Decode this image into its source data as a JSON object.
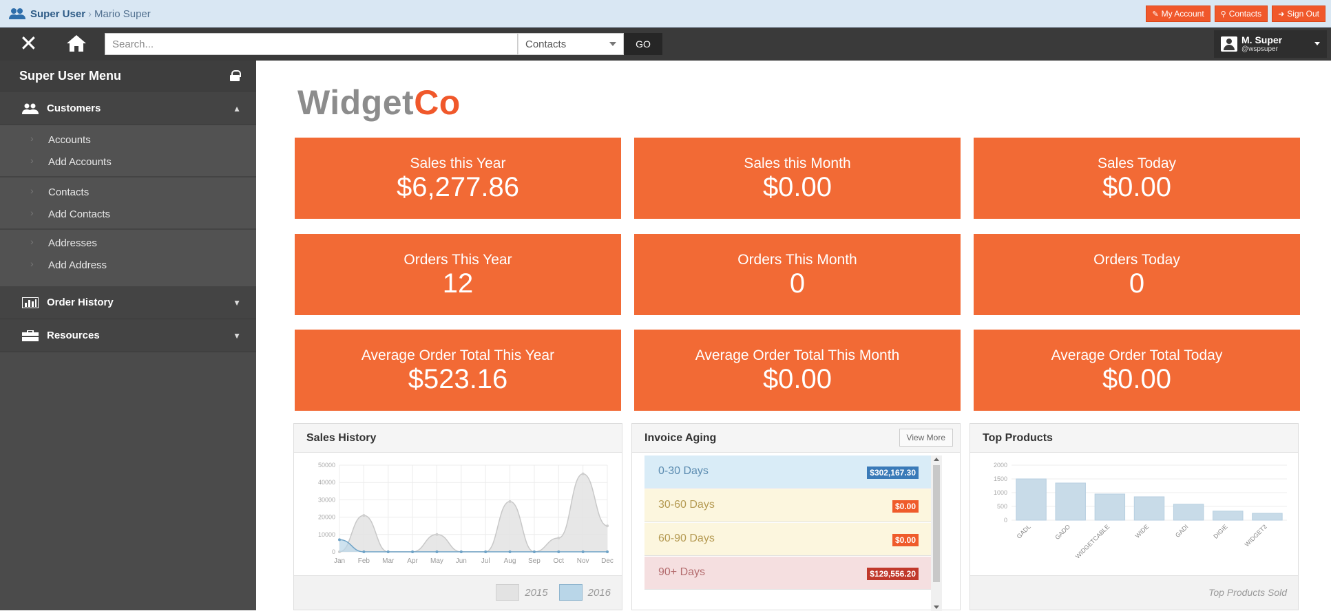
{
  "breadcrumb": {
    "role": "Super User",
    "separator": "›",
    "user": "Mario Super"
  },
  "top_buttons": [
    {
      "icon": "edit-icon",
      "label": "My Account"
    },
    {
      "icon": "search-icon",
      "label": "Contacts"
    },
    {
      "icon": "sign-out-icon",
      "label": "Sign Out"
    }
  ],
  "navbar": {
    "search_placeholder": "Search...",
    "search_scope": "Contacts",
    "go_label": "GO",
    "profile_name": "M. Super",
    "profile_handle": "@wspsuper"
  },
  "sidebar": {
    "title": "Super User Menu",
    "sections": [
      {
        "label": "Customers",
        "expanded": true,
        "items": [
          "Accounts",
          "Add Accounts",
          "Contacts",
          "Add Contacts",
          "Addresses",
          "Add Address"
        ]
      },
      {
        "label": "Order History",
        "expanded": false
      },
      {
        "label": "Resources",
        "expanded": false
      }
    ]
  },
  "logo": {
    "part1": "Widget",
    "part2": "Co"
  },
  "tiles": [
    {
      "label": "Sales this Year",
      "value": "$6,277.86"
    },
    {
      "label": "Sales this Month",
      "value": "$0.00"
    },
    {
      "label": "Sales Today",
      "value": "$0.00"
    },
    {
      "label": "Orders This Year",
      "value": "12"
    },
    {
      "label": "Orders This Month",
      "value": "0"
    },
    {
      "label": "Orders Today",
      "value": "0"
    },
    {
      "label": "Average Order Total This Year",
      "value": "$523.16"
    },
    {
      "label": "Average Order Total This Month",
      "value": "$0.00"
    },
    {
      "label": "Average Order Total Today",
      "value": "$0.00"
    }
  ],
  "colors": {
    "accent": "#f26a35",
    "sidebar": "#4b4b4b",
    "navbar": "#3a3a3a"
  },
  "panels": {
    "sales_history": {
      "title": "Sales History"
    },
    "invoice_aging": {
      "title": "Invoice Aging",
      "view_more": "View More",
      "rows": [
        {
          "label": "0-30 Days",
          "amount": "$302,167.30",
          "bg": "#d9ecf7",
          "text": "#5a8bb0",
          "badge": "#3a7ab8"
        },
        {
          "label": "30-60 Days",
          "amount": "$0.00",
          "bg": "#fcf6de",
          "text": "#b59a52",
          "badge": "#ef5b2b"
        },
        {
          "label": "60-90 Days",
          "amount": "$0.00",
          "bg": "#fcf6de",
          "text": "#b59a52",
          "badge": "#ef5b2b"
        },
        {
          "label": "90+ Days",
          "amount": "$129,556.20",
          "bg": "#f5dfe0",
          "text": "#b46c6e",
          "badge": "#c0392b"
        }
      ]
    },
    "top_products": {
      "title": "Top Products",
      "footer": "Top Products Sold"
    }
  },
  "chart_data": [
    {
      "type": "area",
      "title": "Sales History",
      "categories": [
        "Jan",
        "Feb",
        "Mar",
        "Apr",
        "May",
        "Jun",
        "Jul",
        "Aug",
        "Sep",
        "Oct",
        "Nov",
        "Dec"
      ],
      "y_ticks": [
        "50000",
        "40000",
        "30000",
        "20000",
        "10000",
        "0"
      ],
      "ylim": [
        0,
        50000
      ],
      "series": [
        {
          "name": "2015",
          "values": [
            0,
            21000,
            0,
            0,
            10000,
            0,
            0,
            29000,
            0,
            8000,
            45000,
            15000
          ],
          "color": "#e3e3e3"
        },
        {
          "name": "2016",
          "values": [
            7000,
            0,
            0,
            0,
            0,
            0,
            0,
            0,
            0,
            0,
            0,
            0
          ],
          "color": "#b9d6e8"
        }
      ]
    },
    {
      "type": "bar",
      "title": "Top Products",
      "categories": [
        "GADL",
        "GADO",
        "WIDGETCABLE",
        "WIDE",
        "GADI",
        "DIGIE",
        "WIDGET2"
      ],
      "values": [
        1500,
        1350,
        950,
        850,
        580,
        330,
        250
      ],
      "y_ticks": [
        "2000",
        "1500",
        "1000",
        "500",
        "0"
      ],
      "ylim": [
        0,
        2000
      ],
      "color": "#c8dbe8"
    }
  ]
}
